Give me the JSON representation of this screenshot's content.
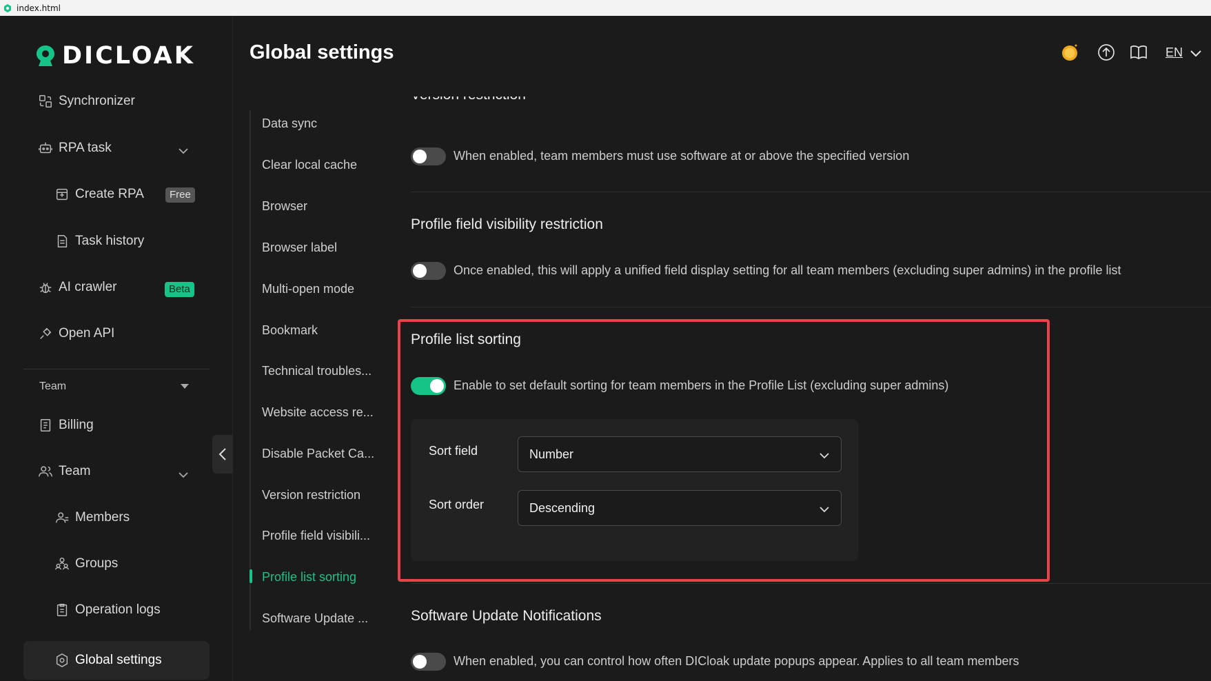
{
  "window": {
    "title": "index.html"
  },
  "brand": {
    "logo_text": "DICLOAK",
    "accent": "#17c488"
  },
  "sidebar": {
    "items": [
      {
        "label": "Synchronizer",
        "icon": "synchronizer-icon"
      },
      {
        "label": "RPA task",
        "icon": "robot-icon"
      },
      {
        "label": "Create RPA",
        "icon": "create-rpa-icon",
        "badge": "Free"
      },
      {
        "label": "Task history",
        "icon": "document-icon"
      },
      {
        "label": "AI crawler",
        "icon": "bug-icon",
        "badge": "Beta"
      },
      {
        "label": "Open API",
        "icon": "plug-icon"
      },
      {
        "label": "Billing",
        "icon": "billing-icon"
      },
      {
        "label": "Team",
        "icon": "team-icon"
      },
      {
        "label": "Members",
        "icon": "members-icon"
      },
      {
        "label": "Groups",
        "icon": "groups-icon"
      },
      {
        "label": "Operation logs",
        "icon": "clipboard-icon"
      },
      {
        "label": "Global settings",
        "icon": "settings-icon",
        "active": true
      }
    ],
    "team_section_label": "Team"
  },
  "header": {
    "title": "Global settings",
    "language": "EN",
    "icons": [
      "coin-icon",
      "upload-icon",
      "book-icon"
    ]
  },
  "subnav": {
    "items": [
      "Data sync",
      "Clear local cache",
      "Browser",
      "Browser label",
      "Multi-open mode",
      "Bookmark",
      "Technical troubles...",
      "Website access re...",
      "Disable Packet Ca...",
      "Version restriction",
      "Profile field visibili...",
      "Profile list sorting",
      "Software Update ..."
    ],
    "active_index": 11
  },
  "sections": {
    "version": {
      "title": "Version restriction",
      "desc": "When enabled, team members must use software at or above the specified version",
      "enabled": false
    },
    "visibility": {
      "title": "Profile field visibility restriction",
      "desc": "Once enabled, this will apply a unified field display setting for all team members (excluding super admins) in the profile list",
      "enabled": false
    },
    "sorting": {
      "title": "Profile list sorting",
      "desc": "Enable to set default sorting for team members in the Profile List (excluding super admins)",
      "enabled": true,
      "sort_field_label": "Sort field",
      "sort_field_value": "Number",
      "sort_order_label": "Sort order",
      "sort_order_value": "Descending"
    },
    "update": {
      "title": "Software Update Notifications",
      "desc": "When enabled, you can control how often DICloak update popups appear. Applies to all team members",
      "enabled": false
    }
  }
}
